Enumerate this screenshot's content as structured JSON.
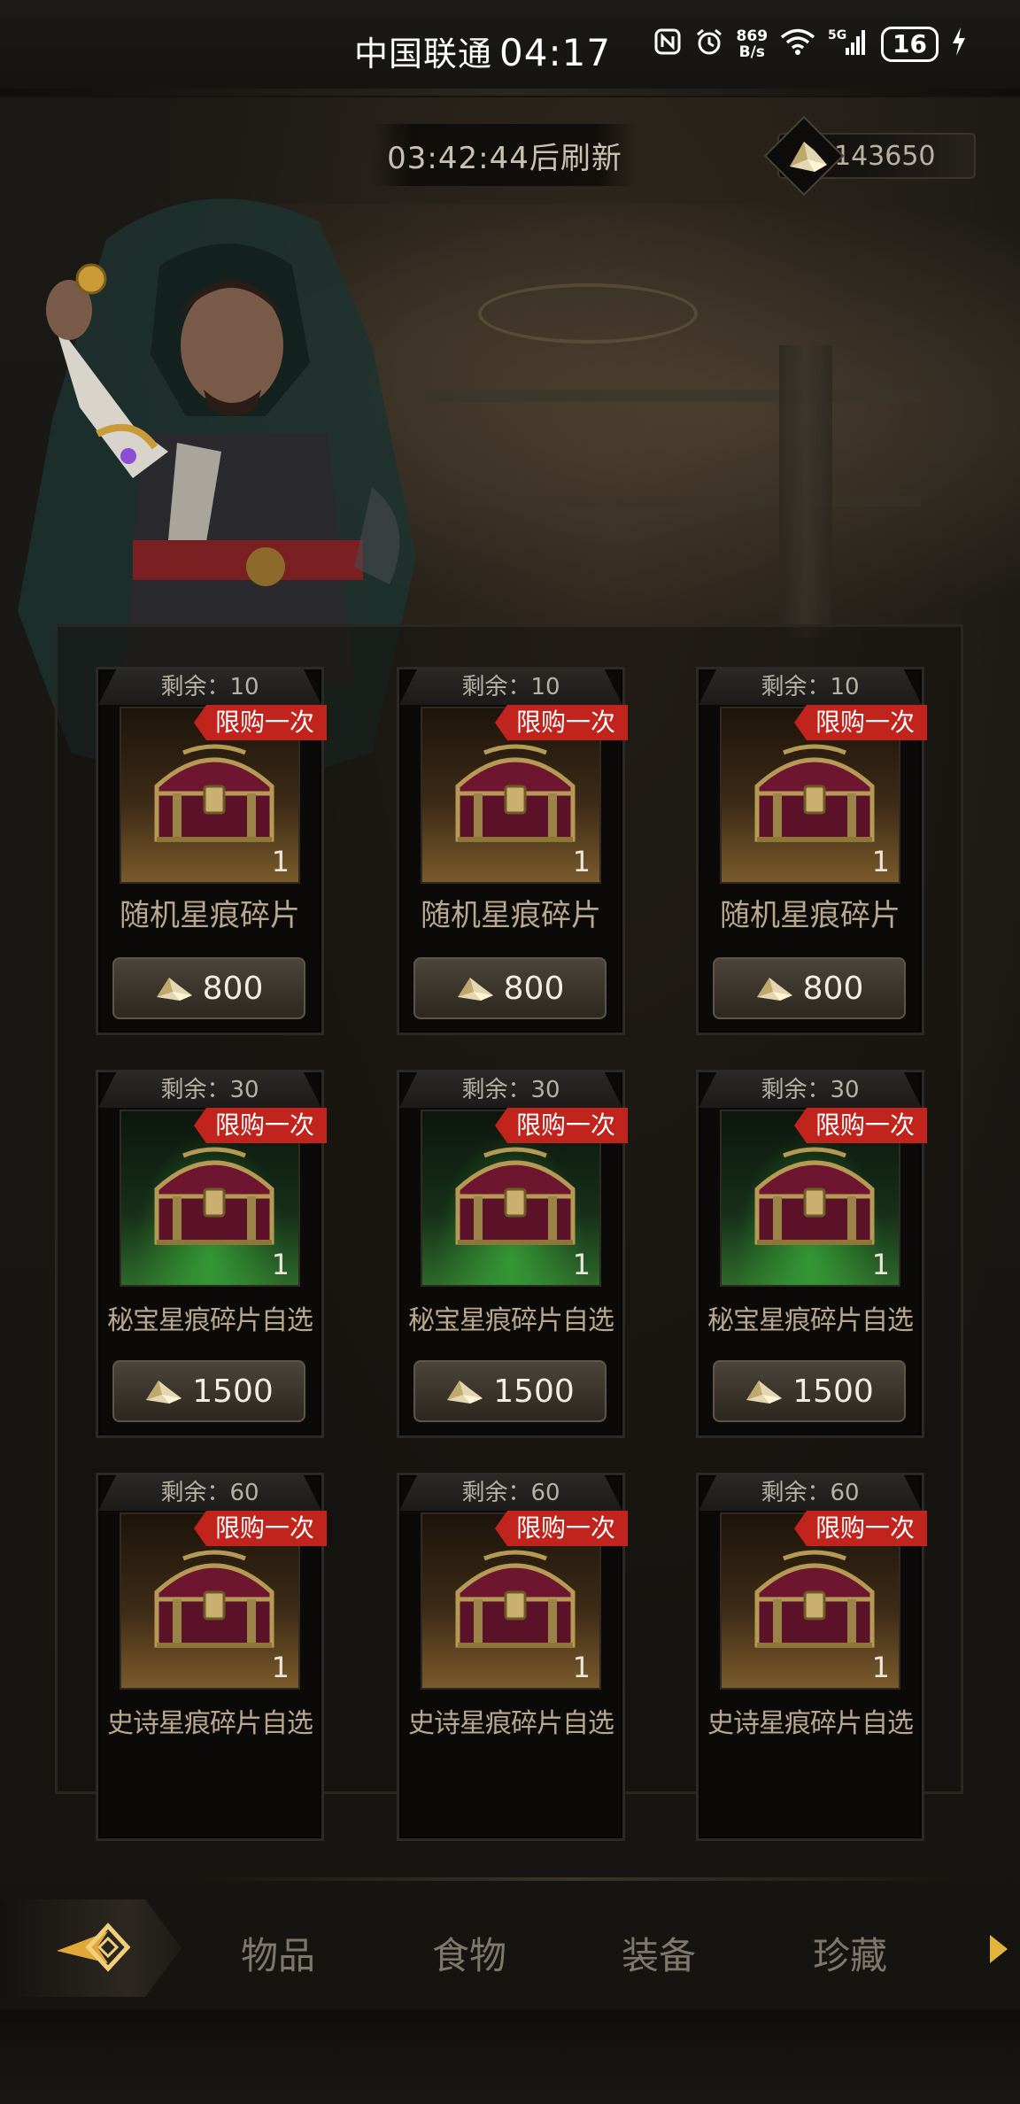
{
  "status_bar": {
    "carrier": "中国联通",
    "time": "04:17",
    "net_speed_value": "869",
    "net_speed_unit": "B/s",
    "signal_label": "5G",
    "battery": "16"
  },
  "header": {
    "refresh_text": "03:42:44后刷新",
    "currency_amount": "143650"
  },
  "items": [
    {
      "remain": "剩余：10",
      "badge": "限购一次",
      "qty": "1",
      "name": "随机星痕碎片",
      "price": "800",
      "bg": "gold"
    },
    {
      "remain": "剩余：10",
      "badge": "限购一次",
      "qty": "1",
      "name": "随机星痕碎片",
      "price": "800",
      "bg": "gold"
    },
    {
      "remain": "剩余：10",
      "badge": "限购一次",
      "qty": "1",
      "name": "随机星痕碎片",
      "price": "800",
      "bg": "gold"
    },
    {
      "remain": "剩余：30",
      "badge": "限购一次",
      "qty": "1",
      "name": "秘宝星痕碎片自选",
      "price": "1500",
      "bg": "green"
    },
    {
      "remain": "剩余：30",
      "badge": "限购一次",
      "qty": "1",
      "name": "秘宝星痕碎片自选",
      "price": "1500",
      "bg": "green"
    },
    {
      "remain": "剩余：30",
      "badge": "限购一次",
      "qty": "1",
      "name": "秘宝星痕碎片自选",
      "price": "1500",
      "bg": "green"
    },
    {
      "remain": "剩余：60",
      "badge": "限购一次",
      "qty": "1",
      "name": "史诗星痕碎片自选",
      "price": "",
      "bg": "gold"
    },
    {
      "remain": "剩余：60",
      "badge": "限购一次",
      "qty": "1",
      "name": "史诗星痕碎片自选",
      "price": "",
      "bg": "gold"
    },
    {
      "remain": "剩余：60",
      "badge": "限购一次",
      "qty": "1",
      "name": "史诗星痕碎片自选",
      "price": "",
      "bg": "gold"
    }
  ],
  "tabs": [
    {
      "label": "物品"
    },
    {
      "label": "食物"
    },
    {
      "label": "装备"
    },
    {
      "label": "珍藏"
    }
  ],
  "icons": {
    "active_tab": "eye-diamond-icon",
    "next": "arrow-right-icon",
    "currency": "gem-shard-icon",
    "item": "treasure-chest-icon"
  },
  "colors": {
    "badge": "#c1231d",
    "accent_gold": "#e3b43b"
  }
}
